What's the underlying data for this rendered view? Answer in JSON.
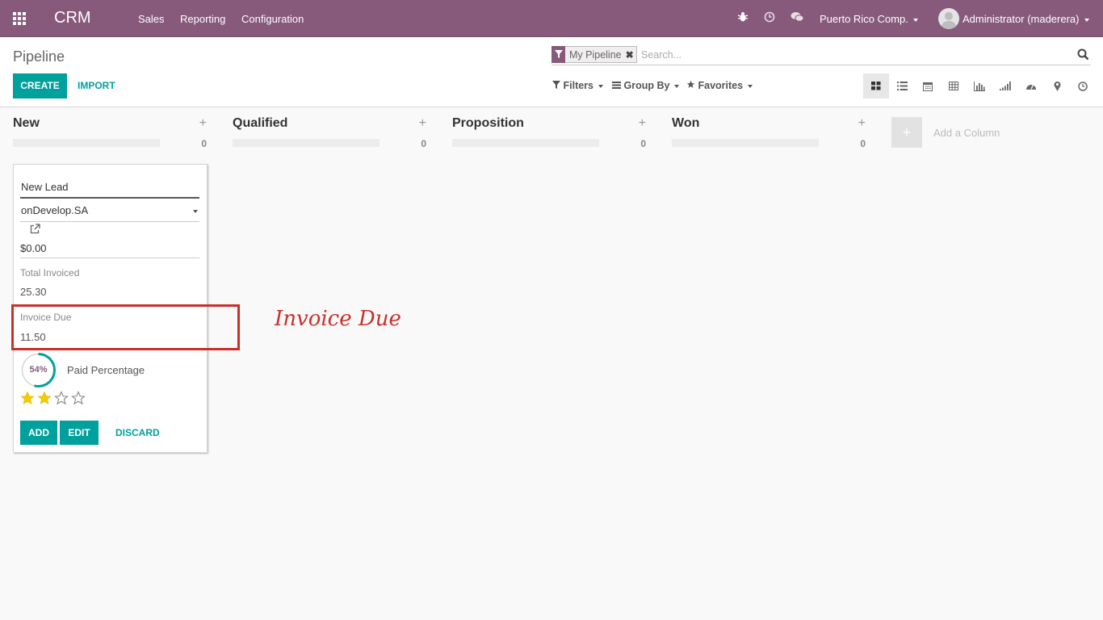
{
  "navbar": {
    "brand": "CRM",
    "menu": [
      "Sales",
      "Reporting",
      "Configuration"
    ],
    "icons": [
      "bug-icon",
      "clock-icon",
      "chat-icon"
    ],
    "company": "Puerto Rico Comp.",
    "user": "Administrator (maderera)"
  },
  "control_panel": {
    "breadcrumb": "Pipeline",
    "create_label": "CREATE",
    "import_label": "IMPORT",
    "search": {
      "facet": "My Pipeline",
      "placeholder": "Search..."
    },
    "filters_label": "Filters",
    "groupby_label": "Group By",
    "favorites_label": "Favorites",
    "views": [
      "kanban",
      "list",
      "calendar",
      "pivot",
      "graph",
      "cohort",
      "dashboard",
      "map",
      "activity"
    ],
    "active_view": "kanban"
  },
  "kanban": {
    "columns": [
      {
        "title": "New",
        "count": "0"
      },
      {
        "title": "Qualified",
        "count": "0"
      },
      {
        "title": "Proposition",
        "count": "0"
      },
      {
        "title": "Won",
        "count": "0"
      }
    ],
    "add_column_label": "Add a Column"
  },
  "quick_create": {
    "name": "New Lead",
    "partner": "onDevelop.SA",
    "revenue": "$0.00",
    "total_invoiced_label": "Total Invoiced",
    "total_invoiced_value": "25.30",
    "invoice_due_label": "Invoice Due",
    "invoice_due_value": "11.50",
    "paid_percentage_value": 54,
    "paid_percentage_text": "54%",
    "paid_percentage_label": "Paid Percentage",
    "priority_stars": 2,
    "priority_max": 4,
    "add_label": "ADD",
    "edit_label": "EDIT",
    "discard_label": "DISCARD"
  },
  "annotation": {
    "text": "Invoice Due"
  },
  "colors": {
    "navbar": "#875a7b",
    "primary": "#00a09d",
    "annotation": "#c9302c",
    "star": "#f3cc00"
  }
}
